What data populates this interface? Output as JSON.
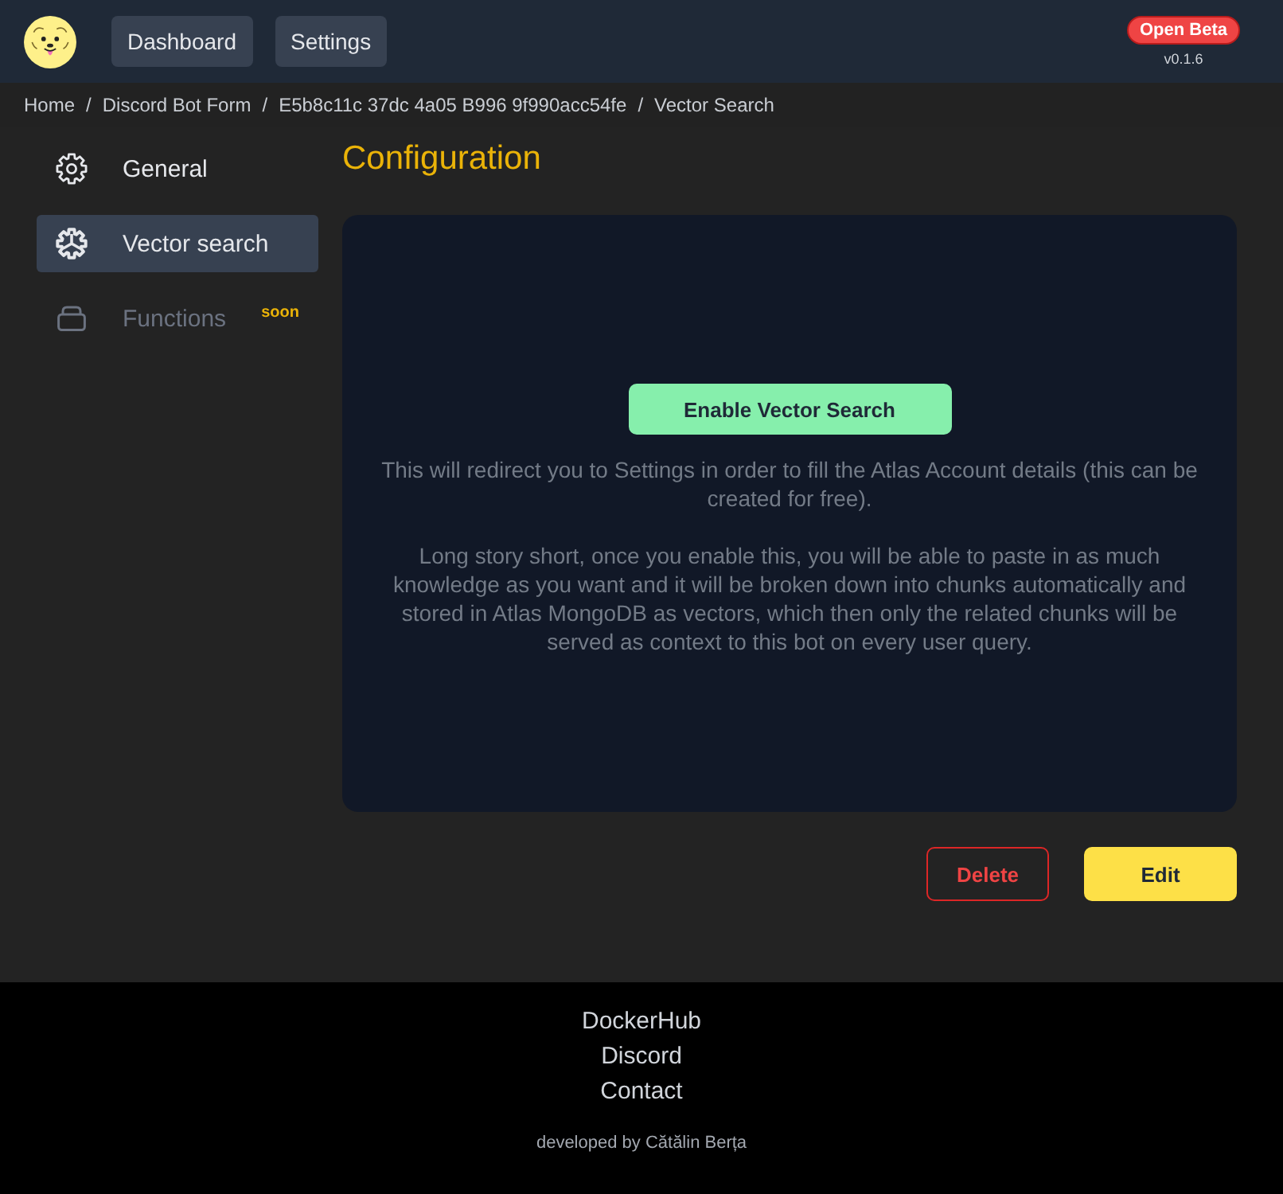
{
  "header": {
    "nav": [
      {
        "label": "Dashboard"
      },
      {
        "label": "Settings"
      }
    ],
    "badge": "Open Beta",
    "version": "v0.1.6"
  },
  "breadcrumb": {
    "items": [
      "Home",
      "Discord Bot Form",
      "E5b8c11c 37dc 4a05 B996 9f990acc54fe",
      "Vector Search"
    ],
    "separators": [
      "/",
      "/",
      "/"
    ]
  },
  "sidebar": {
    "items": [
      {
        "label": "General",
        "selected": false,
        "disabled": false
      },
      {
        "label": "Vector search",
        "selected": true,
        "disabled": false
      },
      {
        "label": "Functions",
        "selected": false,
        "disabled": true,
        "tag": "soon"
      }
    ]
  },
  "main": {
    "title": "Configuration",
    "card": {
      "button": "Enable Vector Search",
      "paragraphs": [
        "This will redirect you to Settings in order to fill the Atlas Account details (this can be created for free).",
        "Long story short, once you enable this, you will be able to paste in as much knowledge as you want and it will be broken down into chunks automatically and stored in Atlas MongoDB as vectors, which then only the related chunks will be served as context to this bot on every user query."
      ]
    },
    "actions": [
      {
        "label": "Delete",
        "kind": "danger"
      },
      {
        "label": "Edit",
        "kind": "primary"
      }
    ]
  },
  "footer": {
    "links": [
      "DockerHub",
      "Discord",
      "Contact"
    ],
    "credit": "developed by Cătălin Berța"
  }
}
